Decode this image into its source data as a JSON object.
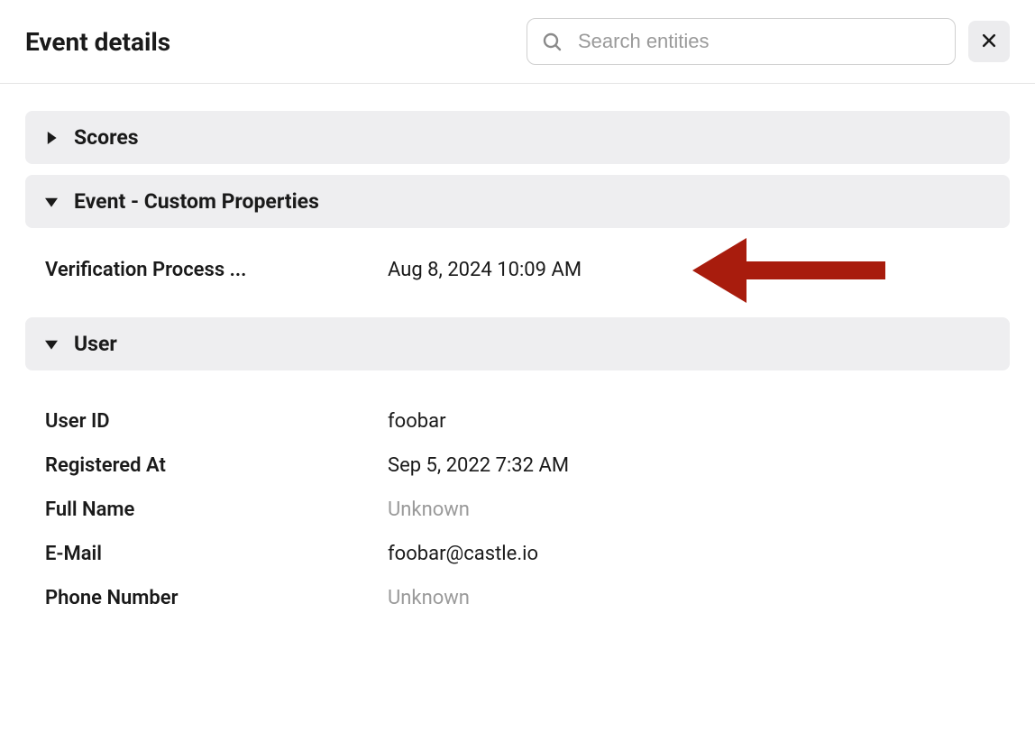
{
  "header": {
    "title": "Event details",
    "search_placeholder": "Search entities"
  },
  "sections": {
    "scores": {
      "title": "Scores",
      "expanded": false
    },
    "custom_props": {
      "title": "Event - Custom Properties",
      "expanded": true,
      "rows": [
        {
          "label": "Verification Process ...",
          "value": "Aug 8, 2024 10:09 AM",
          "muted": false
        }
      ]
    },
    "user": {
      "title": "User",
      "expanded": true,
      "rows": [
        {
          "label": "User ID",
          "value": "foobar",
          "muted": false
        },
        {
          "label": "Registered At",
          "value": "Sep 5, 2022 7:32 AM",
          "muted": false
        },
        {
          "label": "Full Name",
          "value": "Unknown",
          "muted": true
        },
        {
          "label": "E-Mail",
          "value": "foobar@castle.io",
          "muted": false
        },
        {
          "label": "Phone Number",
          "value": "Unknown",
          "muted": true
        }
      ]
    }
  },
  "annotation": {
    "type": "arrow",
    "color": "#a81c0d"
  }
}
